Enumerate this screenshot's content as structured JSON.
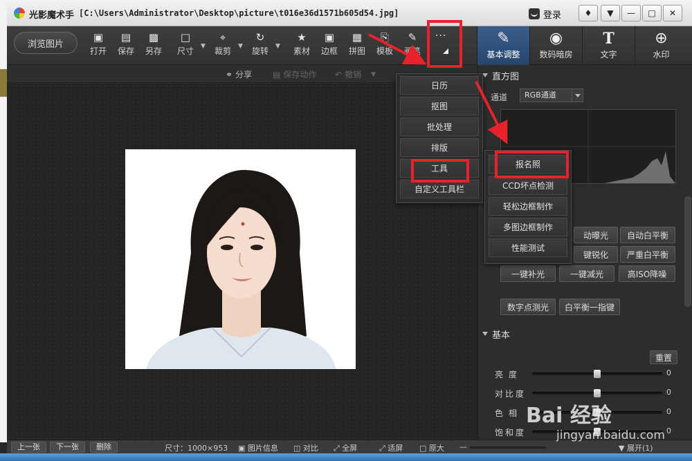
{
  "window": {
    "app_name": "光影魔术手",
    "file_path": "[C:\\Users\\Administrator\\Desktop\\picture\\t016e36d1571b605d54.jpg]",
    "login_label": "登录"
  },
  "toolbar": {
    "browse_label": "浏览图片",
    "tools": [
      {
        "label": "打开",
        "icon": "open-icon"
      },
      {
        "label": "保存",
        "icon": "save-icon"
      },
      {
        "label": "另存",
        "icon": "save-as-icon"
      },
      {
        "label": "尺寸",
        "icon": "resize-icon"
      },
      {
        "label": "裁剪",
        "icon": "crop-icon"
      },
      {
        "label": "旋转",
        "icon": "rotate-icon"
      },
      {
        "label": "素材",
        "icon": "material-icon"
      },
      {
        "label": "边框",
        "icon": "frame-icon"
      },
      {
        "label": "拼图",
        "icon": "collage-icon"
      },
      {
        "label": "模板",
        "icon": "template-icon"
      },
      {
        "label": "画笔",
        "icon": "brush-icon"
      }
    ],
    "more_dots": "...",
    "right_tabs": [
      {
        "label": "基本调整",
        "icon": "adjust-icon"
      },
      {
        "label": "数码暗房",
        "icon": "darkroom-icon"
      },
      {
        "label": "文字",
        "icon": "text-icon"
      },
      {
        "label": "水印",
        "icon": "watermark-icon"
      }
    ]
  },
  "subbar": {
    "share": "分享",
    "save_action": "保存动作",
    "undo": "撤销"
  },
  "more_menu": {
    "items": [
      "日历",
      "抠图",
      "批处理",
      "排版",
      "工具",
      "自定义工具栏"
    ]
  },
  "tools_menu": {
    "items": [
      "报名照",
      "CCD坏点检测",
      "轻松边框制作",
      "多图边框制作",
      "性能测试"
    ]
  },
  "panel": {
    "histogram_title": "直方图",
    "channel_label": "通道",
    "channel_value": "RGB通道",
    "auto_buttons": [
      [
        "动曝光",
        "自动白平衡"
      ],
      [
        "键锐化",
        "严重白平衡"
      ],
      [
        "一键补光",
        "一键减光",
        "高ISO降噪"
      ],
      [
        "数字点测光",
        "白平衡一指键"
      ]
    ],
    "basic_title": "基本",
    "reset_label": "重置",
    "sliders": [
      {
        "name": "亮度",
        "value": "0",
        "level": 0.5
      },
      {
        "name": "对比度",
        "value": "0",
        "level": 0.5
      },
      {
        "name": "色相",
        "value": "0",
        "level": 0.5
      },
      {
        "name": "饱和度",
        "value": "0",
        "level": 0.5
      }
    ]
  },
  "statusbar": {
    "prev": "上一张",
    "next": "下一张",
    "delete": "删除",
    "size": "尺寸：1000×953",
    "info": "图片信息",
    "compare": "对比",
    "fullscreen": "全屏",
    "fit": "适屏",
    "original": "原大",
    "expand": "展开(1)"
  },
  "watermark": {
    "main": "Bai 经验",
    "sub": "jingyan.baidu.com"
  },
  "colors": {
    "annotation_red": "#e8222b",
    "active_tab": "#2f5280"
  }
}
